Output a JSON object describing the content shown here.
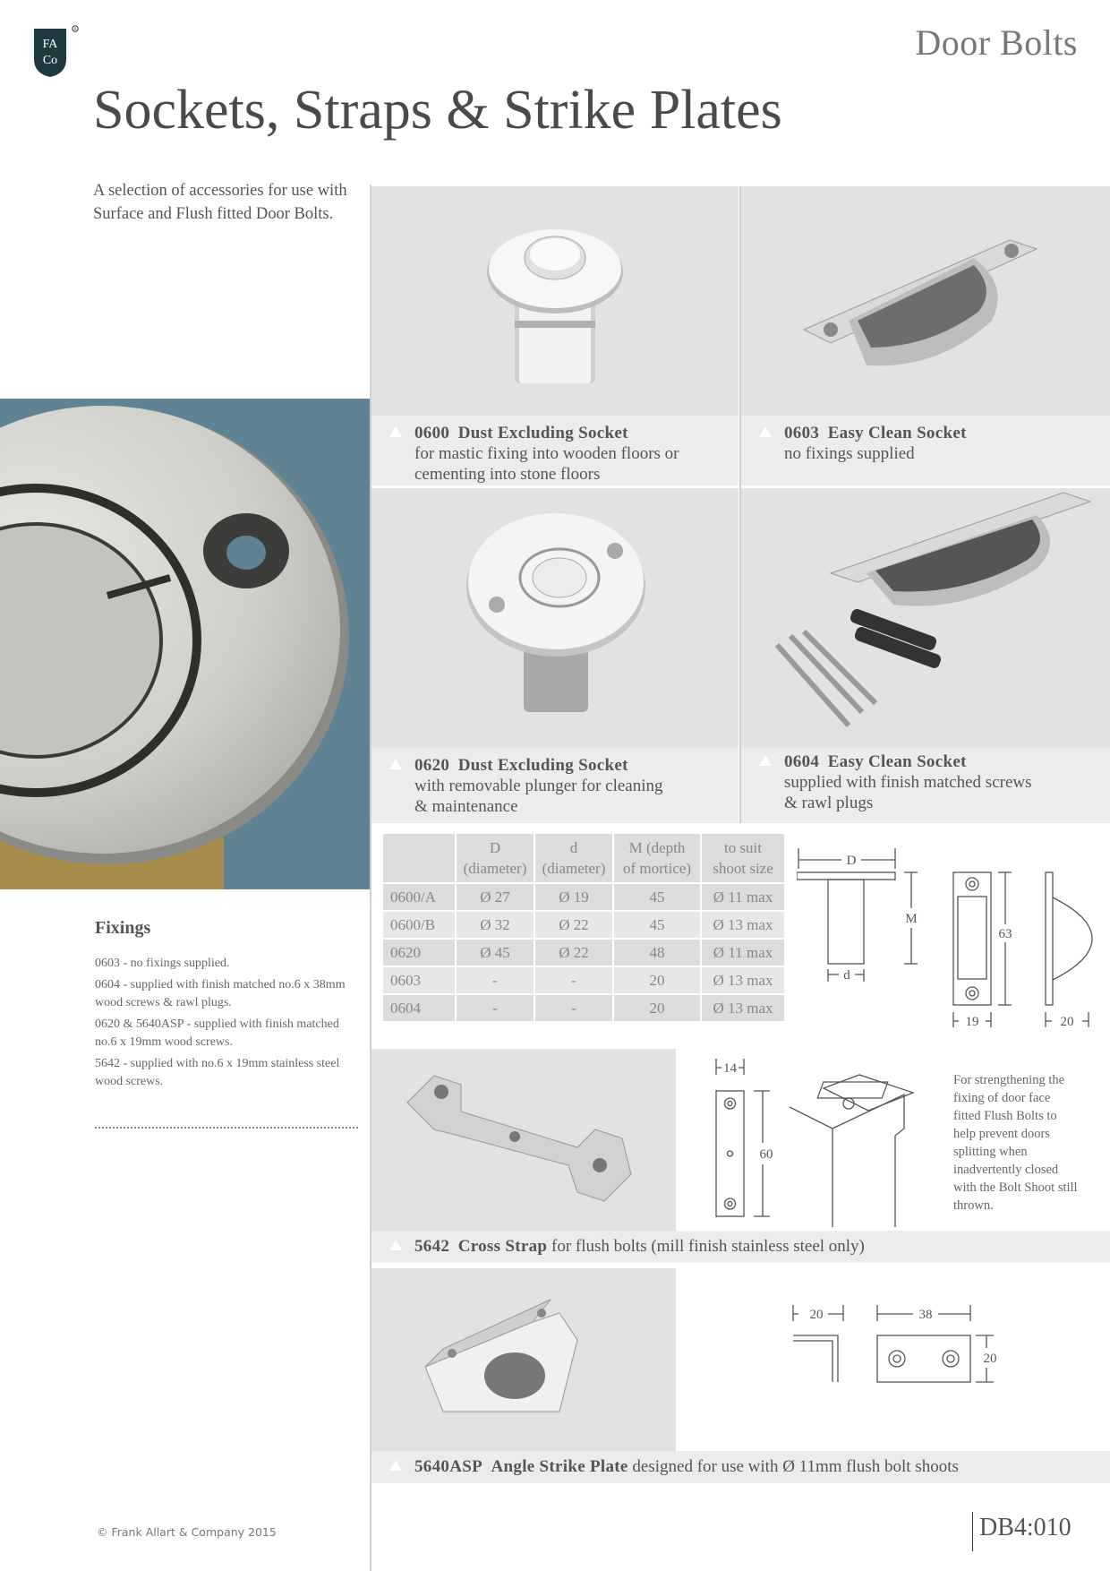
{
  "header": {
    "section": "Door Bolts",
    "title": "Sockets, Straps & Strike Plates",
    "logo_letters": "FA Co",
    "intro": "A selection of accessories for use with Surface and Flush fitted Door Bolts."
  },
  "products": [
    {
      "code": "0600",
      "name": "Dust Excluding Socket",
      "desc_lines": [
        "for mastic fixing into wooden floors or",
        "cementing into stone floors"
      ]
    },
    {
      "code": "0603",
      "name": "Easy Clean Socket",
      "desc_lines": [
        "no fixings supplied"
      ]
    },
    {
      "code": "0620",
      "name": "Dust Excluding Socket",
      "desc_lines": [
        "with removable plunger for cleaning",
        "& maintenance"
      ]
    },
    {
      "code": "0604",
      "name": "Easy Clean Socket",
      "desc_lines": [
        "supplied with finish matched screws",
        "& rawl plugs"
      ]
    },
    {
      "code": "5642",
      "name": "Cross Strap",
      "desc": "for flush bolts (mill finish stainless steel only)"
    },
    {
      "code": "5640ASP",
      "name": "Angle Strike Plate",
      "desc": "designed for use with Ø 11mm flush bolt shoots"
    }
  ],
  "fixings": {
    "title": "Fixings",
    "items": [
      "0603 - no fixings supplied.",
      "0604 - supplied with finish matched no.6 x 38mm wood screws & rawl plugs.",
      "0620 & 5640ASP - supplied with finish matched no.6 x 19mm wood screws.",
      "5642 - supplied with no.6 x 19mm stainless steel wood screws."
    ]
  },
  "table": {
    "headers": [
      [
        "",
        ""
      ],
      [
        "D",
        "(diameter)"
      ],
      [
        "d",
        "(diameter)"
      ],
      [
        "M (depth",
        "of mortice)"
      ],
      [
        "to suit",
        "shoot size"
      ]
    ],
    "rows": [
      [
        "0600/A",
        "Ø 27",
        "Ø 19",
        "45",
        "Ø 11 max"
      ],
      [
        "0600/B",
        "Ø 32",
        "Ø 22",
        "45",
        "Ø 13 max"
      ],
      [
        "0620",
        "Ø 45",
        "Ø 22",
        "48",
        "Ø 11 max"
      ],
      [
        "0603",
        "-",
        "-",
        "20",
        "Ø 13 max"
      ],
      [
        "0604",
        "-",
        "-",
        "20",
        "Ø 13 max"
      ]
    ]
  },
  "diagrams": {
    "socket": {
      "D": "D",
      "M": "M",
      "d": "d"
    },
    "easy_clean": {
      "height": "63",
      "width": "19",
      "depth": "20"
    },
    "strap": {
      "width": "14",
      "height": "60"
    },
    "strike": {
      "leg": "20",
      "width": "38",
      "height": "20"
    }
  },
  "strap_note": "For strengthening the fixing of door face fitted Flush Bolts to help prevent doors splitting when inadvertently closed with the Bolt Shoot still thrown.",
  "footer": {
    "copyright": "© Frank Allart & Company 2015",
    "page_number": "DB4:010"
  },
  "colors": {
    "hero_background": "#5f8393",
    "panel_background": "#e2e2e2",
    "caption_background": "#ececec",
    "logo": "#1f3a3f"
  }
}
